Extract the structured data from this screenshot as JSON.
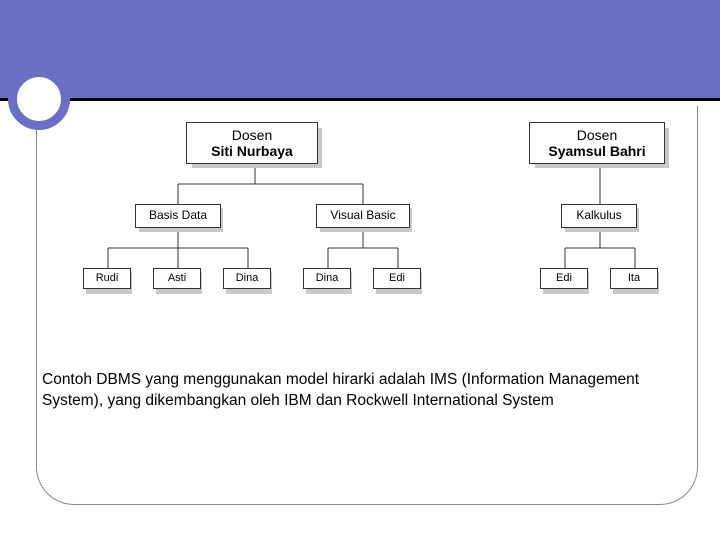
{
  "roots": [
    {
      "line1": "Dosen",
      "line2": "Siti Nurbaya"
    },
    {
      "line1": "Dosen",
      "line2": "Syamsul Bahri"
    }
  ],
  "mids": [
    {
      "label": "Basis Data"
    },
    {
      "label": "Visual Basic"
    },
    {
      "label": "Kalkulus"
    }
  ],
  "leaves": [
    {
      "label": "Rudi"
    },
    {
      "label": "Asti"
    },
    {
      "label": "Dina"
    },
    {
      "label": "Dina"
    },
    {
      "label": "Edi"
    },
    {
      "label": "Edi"
    },
    {
      "label": "Ita"
    }
  ],
  "caption": "Contoh DBMS yang menggunakan model hirarki adalah IMS (Information Management System), yang dikembangkan oleh IBM dan Rockwell International System"
}
